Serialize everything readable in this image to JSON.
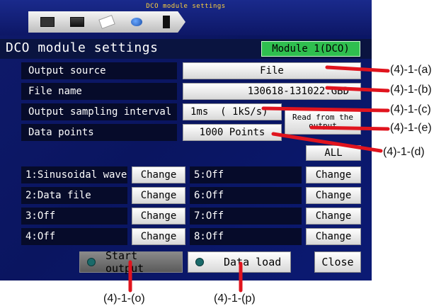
{
  "window": {
    "title": "DCO module settings"
  },
  "breadcrumb": {
    "icons": [
      "monitor-icon",
      "panel-icon",
      "paper-icon",
      "graph-icon",
      "device-icon"
    ]
  },
  "header": {
    "title": "DCO module settings",
    "module": "Module  1(DCO)"
  },
  "settings": {
    "output_source": {
      "label": "Output source",
      "value": "File"
    },
    "file_name": {
      "label": "File name",
      "value": "130618-131022.GBD"
    },
    "sampling": {
      "label": "Output sampling interval",
      "value": "1ms  ( 1kS/s)"
    },
    "data_points": {
      "label": "Data points",
      "value": "1000 Points"
    },
    "read_btn": "Read from the output"
  },
  "channels": {
    "all_label": "ALL",
    "change_label": "Change",
    "left": [
      "1:Sinusoidal wave",
      "2:Data file",
      "3:Off",
      "4:Off"
    ],
    "right": [
      "5:Off",
      "6:Off",
      "7:Off",
      "8:Off"
    ]
  },
  "footer": {
    "start": "Start output",
    "load": "Data load",
    "close": "Close"
  },
  "callouts": {
    "a": "(4)-1-(a)",
    "b": "(4)-1-(b)",
    "c": "(4)-1-(c)",
    "e": "(4)-1-(e)",
    "d": "(4)-1-(d)",
    "o": "(4)-1-(o)",
    "p": "(4)-1-(p)"
  },
  "colors": {
    "accent": "#2fbf4f",
    "background": "#0f1a6b",
    "callout_line": "#e0141e"
  }
}
